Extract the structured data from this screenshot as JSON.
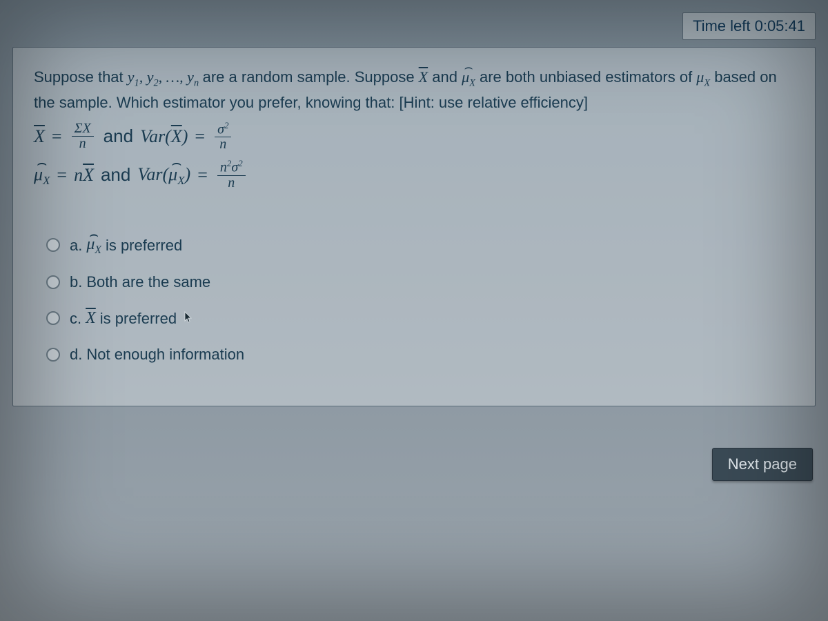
{
  "timer": {
    "label": "Time left 0:05:41"
  },
  "question": {
    "stem_part1": "Suppose that ",
    "stem_sample": "y₁, y₂, …, yₙ",
    "stem_part2": " are a random sample. Suppose ",
    "stem_part3": " and ",
    "stem_part4": " are both unbiased estimators of ",
    "stem_part5": " based on the sample. Which estimator you prefer, knowing that: [Hint: use relative efficiency]",
    "eq1_lhs": "X",
    "eq1_num": "ΣX",
    "eq1_den": "n",
    "eq1_joiner": "and",
    "eq1_var_label": "Var(X̄)",
    "eq1_var_num": "σ²",
    "eq1_var_den": "n",
    "eq2_lhs_pre": "μ",
    "eq2_lhs_sub": "X",
    "eq2_rhs": "= nX̄",
    "eq2_joiner": "and",
    "eq2_var_label_pre": "Var(",
    "eq2_var_label_post": ")",
    "eq2_var_num": "n²σ²",
    "eq2_var_den": "n"
  },
  "answers": {
    "a_letter": "a.",
    "a_text": " is preferred",
    "b_letter": "b.",
    "b_text": "Both are the same",
    "c_letter": "c.",
    "c_text": " is preferred",
    "d_letter": "d.",
    "d_text": "Not enough information"
  },
  "buttons": {
    "next": "Next page"
  }
}
